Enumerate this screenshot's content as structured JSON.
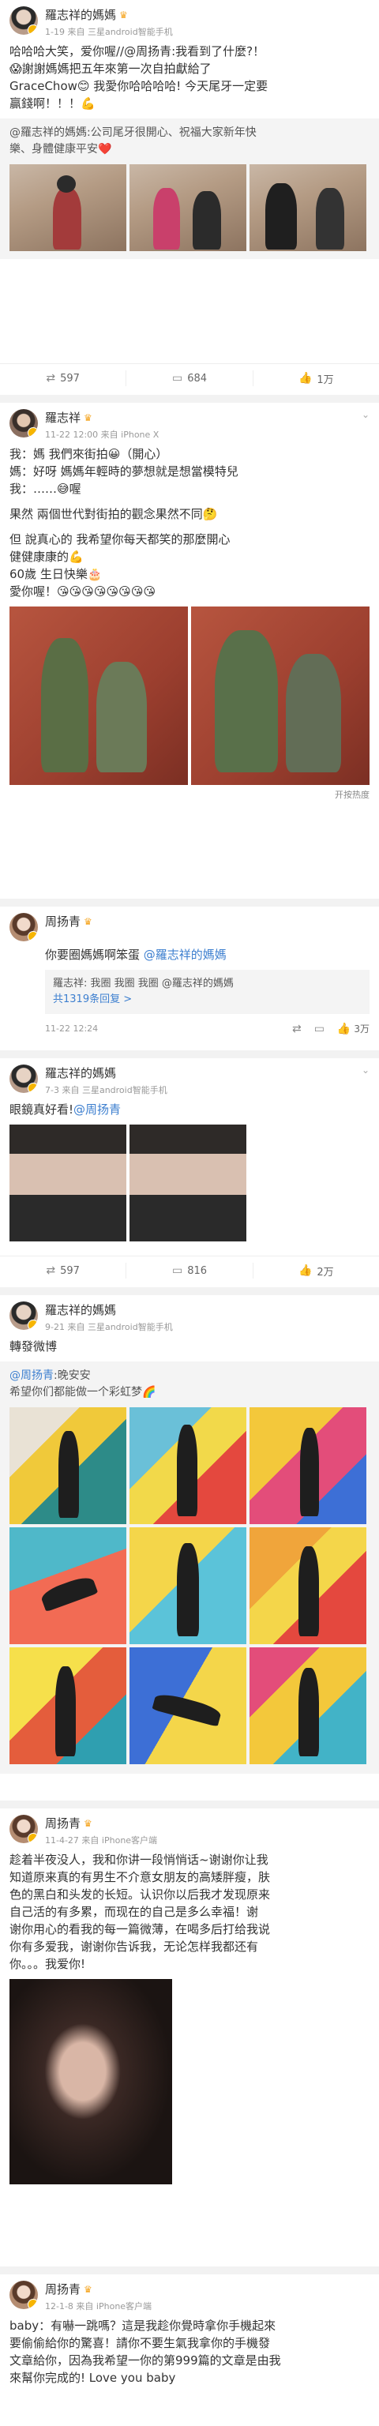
{
  "posts": [
    {
      "user": "羅志祥的媽媽",
      "meta": "1-19  来自 三星android智能手机",
      "lines": [
        "哈哈哈大笑，爱你喔//@周扬青:我看到了什麼?！",
        "😱謝謝媽媽把五年來第一次自拍獻給了",
        "GraceChow😊 我愛你哈哈哈哈! 今天尾牙一定要",
        "贏錢啊！！！💪"
      ],
      "repost_user": "@羅志祥的媽媽",
      "repost_lines": [
        "@羅志祥的媽媽:公司尾牙很開心、祝福大家新年快",
        "樂、身體健康平安❤️"
      ],
      "actions": [
        "597",
        "684",
        "1万"
      ]
    },
    {
      "user": "羅志祥",
      "meta": "11-22 12:00  来自 iPhone X",
      "lines": [
        "我：媽 我們來街拍😀（開心）",
        "媽：好呀 媽媽年輕時的夢想就是想當模特兒",
        "我：……😅喔",
        "",
        "果然 兩個世代對街拍的觀念果然不同🤔",
        "",
        "但 說真心的 我希望你每天都笑的那麼開心",
        "健健康康的💪",
        "60歲 生日快樂🎂",
        "愛你喔！😘😘😘😘😘😘😘😘"
      ],
      "more": "开按热度"
    },
    {
      "user": "周扬青",
      "text_pre": "你要圈媽媽啊笨蛋 ",
      "text_mention": "@羅志祥的媽媽",
      "reply_line": "羅志祥: 我圈 我圈 我圈 @羅志祥的媽媽",
      "reply_count": "共1319条回复 >",
      "meta": "11-22 12:24",
      "actions": [
        "",
        "",
        "3万"
      ]
    },
    {
      "user": "羅志祥的媽媽",
      "meta": "7-3  来自 三星android智能手机",
      "text_pre": "眼鏡真好看!",
      "text_mention": "@周扬青",
      "actions": [
        "597",
        "816",
        "2万"
      ]
    },
    {
      "user": "羅志祥的媽媽",
      "meta": "9-21  来自 三星android智能手机",
      "text": "轉發微博",
      "repost_user": "@周扬青",
      "repost_line1": ":晚安安",
      "repost_line2": "希望你们都能做一个彩虹梦🌈"
    },
    {
      "user": "周扬青",
      "meta": "11-4-27  来自 iPhone客户端",
      "lines": [
        "趁着半夜没人，我和你讲一段悄悄话~谢谢你让我",
        "知道原来真的有男生不介意女朋友的高矮胖瘦，肤",
        "色的黑白和头发的长短。认识你以后我才发现原来",
        "自己活的有多累，而现在的自己是多么幸福！谢",
        "谢你用心的看我的每一篇微薄，在喝多后打给我说",
        "你有多爱我，谢谢你告诉我，无论怎样我都还有",
        "你。。。我爱你!"
      ]
    },
    {
      "user": "周扬青",
      "meta": "12-1-8  来自 iPhone客户端",
      "lines": [
        "baby：有嚇一跳嗎？這是我趁你覺時拿你手機起來",
        "要偷偷給你的驚喜！請你不要生氣我拿你的手機發",
        "文章給你，因為我希望一你的第999篇的文章是由我",
        "來幫你完成的!  Love you baby"
      ]
    }
  ],
  "icons": {
    "repost": "repost-icon",
    "comment": "comment-icon",
    "like": "like-icon"
  }
}
